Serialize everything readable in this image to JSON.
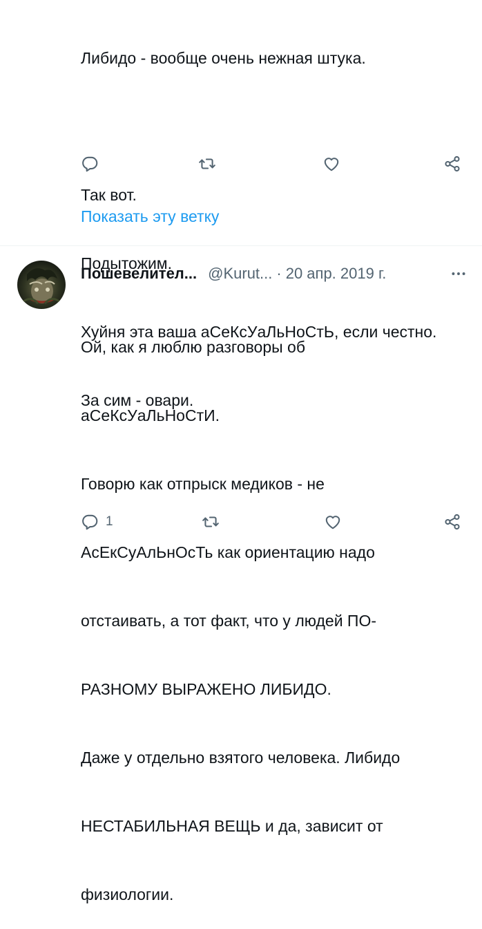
{
  "tweet1": {
    "text_lines": [
      "Либидо - вообще очень нежная штука.",
      "",
      "Так вот.",
      "Подытожим.",
      "Хуйня эта ваша аСеКсУаЛьНоСтЬ, если честно.",
      "За сим - овари."
    ],
    "show_thread_label": "Показать эту ветку"
  },
  "tweet2": {
    "author_name": "Пошевелител...",
    "handle": "@Kurut...",
    "separator": "·",
    "date": "20 апр. 2019 г.",
    "text_lines": [
      "Ой, как я люблю разговоры об",
      "аСеКсУаЛьНоСтИ.",
      "Говорю как отпрыск медиков - не",
      "АсЕкСуАлЬнОсТь как ориентацию надо",
      "отстаивать, а тот факт, что у людей ПО-",
      "РАЗНОМУ ВЫРАЖЕНО ЛИБИДО.",
      "Даже у отдельно взятого человека. Либидо",
      "НЕСТАБИЛЬНАЯ ВЕЩЬ и да, зависит от",
      "физиологии."
    ],
    "reply_count": "1"
  },
  "icons": {
    "reply": "reply-icon",
    "retweet": "retweet-icon",
    "like": "heart-icon",
    "share": "share-icon",
    "more": "more-icon"
  },
  "colors": {
    "text": "#0f1419",
    "secondary": "#536471",
    "link": "#1d9bf0",
    "divider": "#eff3f4"
  }
}
